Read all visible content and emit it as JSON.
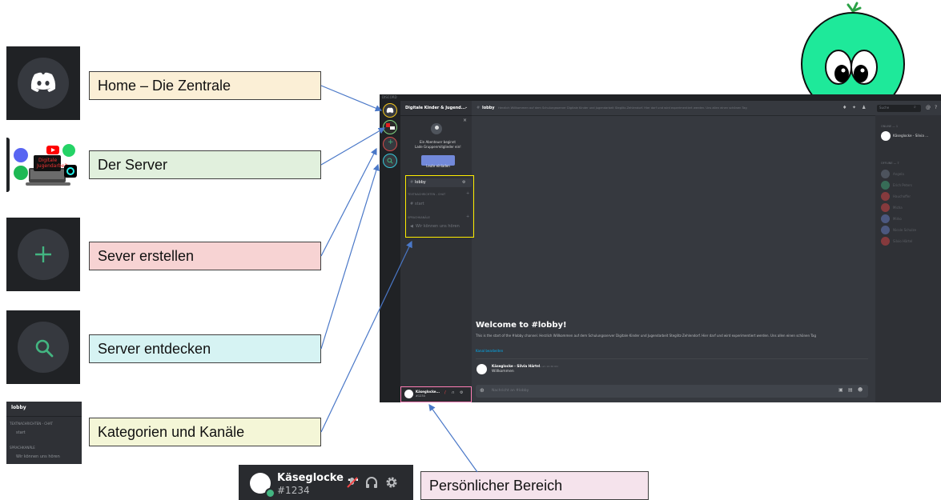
{
  "callouts": {
    "home": "Home – Die Zentrale",
    "server": "Der Server",
    "create": "Sever erstellen",
    "discover": "Server entdecken",
    "categories": "Kategorien und Kanäle",
    "personal": "Persönlicher Bereich"
  },
  "thumb_categories": {
    "channel": "lobby",
    "text_category": "TEXTNACHRICHTEN - CHAT",
    "text_channel": "start",
    "voice_category": "SPRACHKANÄLE",
    "voice_channel": "Wir können uns hören"
  },
  "thumb_user": {
    "name": "Käseglocke ...",
    "tag": "#1234"
  },
  "discord": {
    "window_title": "DISCORD",
    "server_name": "Digitale Kinder & Jugend...",
    "invite_line1": "Ein Abenteuer beginnt",
    "invite_line2": "Lade Gruppenmitglieder ein!",
    "invite_button": "Leute einladen",
    "channel_selected": "lobby",
    "category_text": "TEXTNACHRICHTEN - CHAT",
    "channel_start": "start",
    "category_voice": "SPRACHKANÄLE",
    "voice_channel": "Wir können uns hören",
    "topic_channel": "lobby",
    "topic": "Herzlich Willkommen auf dem Schulungsserver Digitale Kinder und Jugendarbeit Steglitz-Zehlendorf. Hier darf und wird experimentiert werden. Uns allen einen schönen Tag",
    "search_placeholder": "Suche",
    "welcome_title": "Welcome to #lobby!",
    "welcome_text": "This is the start of the #lobby channel. Herzlich Willkommen auf dem Schulungsserver Digitale Kinder und Jugendarbeit Steglitz-Zehlendorf. Hier darf und wird experimentiert werden. Uns allen einen schönen Tag",
    "edit_channel": "Kanal bearbeiten",
    "message_author": "Käseglocke - Silvia Härtel",
    "message_time": "heute um 10:36 Uhr",
    "message_text": "Willkommen",
    "input_placeholder": "Nachricht an #lobby",
    "user_name": "Käseglocke...",
    "user_tag": "#1234",
    "online_header": "ONLINE — 1",
    "online_member": "Käseglocke - Silvia ...",
    "offline_header": "OFFLINE — 7",
    "offline_members": [
      "Angela",
      "Erich Peters",
      "Hauchoffer",
      "Micha",
      "Mirko",
      "Nicole Schulze",
      "Silvio Härtel"
    ]
  },
  "colors": {
    "home_label": "#fbefd6",
    "server_label": "#e1f0dd",
    "create_label": "#f7d3d3",
    "discover_label": "#d6f3f3",
    "categories_label": "#f4f6d7",
    "personal_label": "#f5e3ec",
    "arrow": "#4a78c8",
    "blurple": "#7289da",
    "green": "#43b581",
    "mascot": "#1ee99a"
  }
}
